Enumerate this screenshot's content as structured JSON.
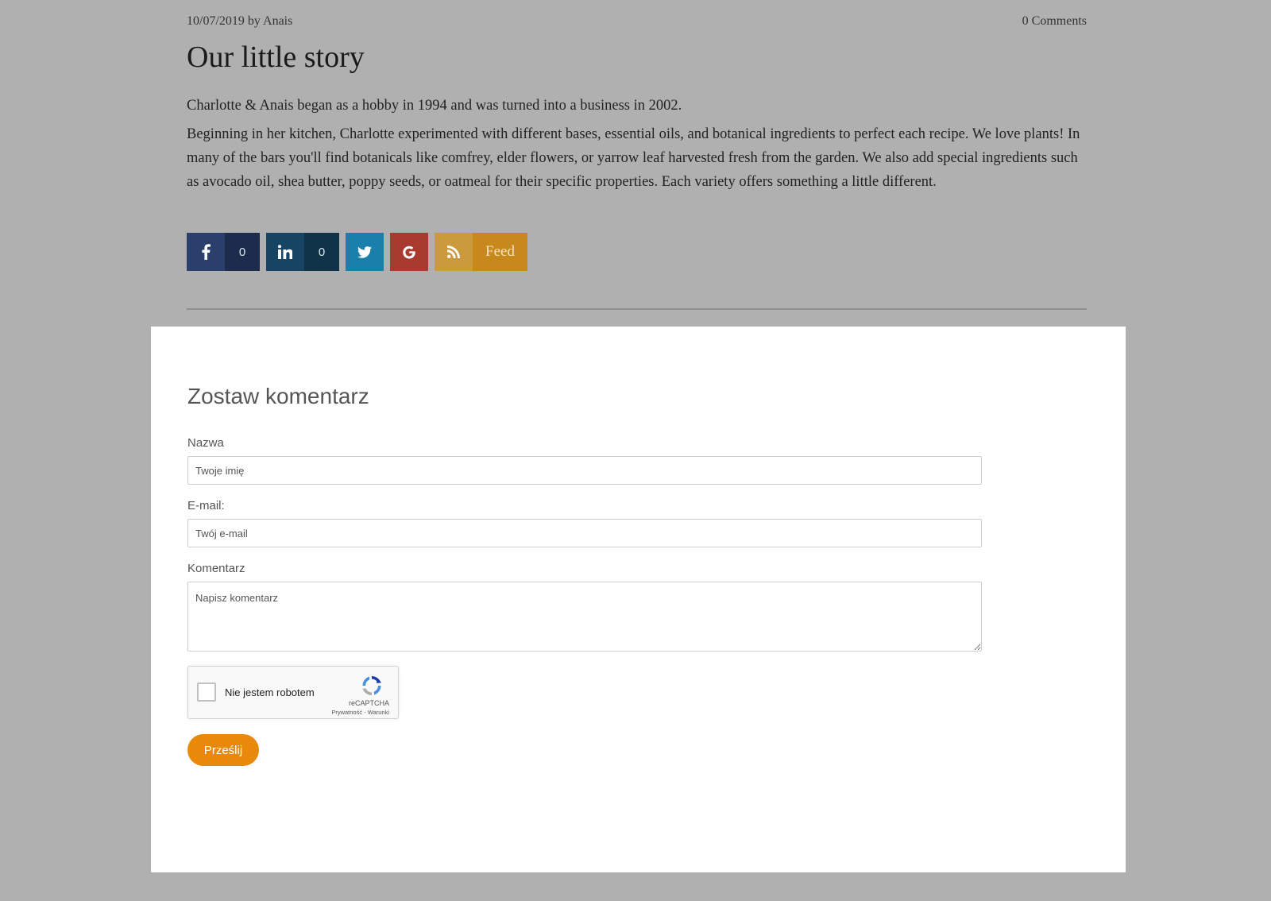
{
  "post": {
    "date_author": "10/07/2019 by Anais",
    "comments_link": "0 Comments",
    "title": "Our little story",
    "paragraphs": [
      "Charlotte & Anais began as a hobby in 1994 and was turned into a business in 2002.",
      "Beginning in her kitchen, Charlotte experimented with different bases, essential oils, and botanical ingredients to perfect each recipe.  We love plants!  In many of the bars you'll find botanicals like comfrey, elder flowers, or yarrow leaf harvested fresh from the garden.  We also add special ingredients such as avocado oil, shea butter, poppy seeds, or oatmeal for their specific properties. Each variety offers something a little different."
    ]
  },
  "share": {
    "facebook": {
      "icon": "facebook-icon",
      "count": "0",
      "color": "#2a3f6b"
    },
    "linkedin": {
      "icon": "linkedin-icon",
      "count": "0",
      "color": "#174463"
    },
    "twitter": {
      "icon": "twitter-icon",
      "color": "#1a7fab"
    },
    "google": {
      "icon": "google-icon",
      "color": "#a83a30"
    },
    "rss": {
      "icon": "rss-icon",
      "label": "Feed",
      "color": "#c8891c"
    }
  },
  "comment_form": {
    "title": "Zostaw komentarz",
    "name_label": "Nazwa",
    "name_placeholder": "Twoje imię",
    "email_label": "E-mail:",
    "email_placeholder": "Twój e-mail",
    "comment_label": "Komentarz",
    "comment_placeholder": "Napisz komentarz",
    "captcha": {
      "label": "Nie jestem robotem",
      "brand": "reCAPTCHA",
      "links": "Prywatność - Warunki"
    },
    "submit_label": "Prześlij",
    "submit_color": "#e8890c"
  }
}
